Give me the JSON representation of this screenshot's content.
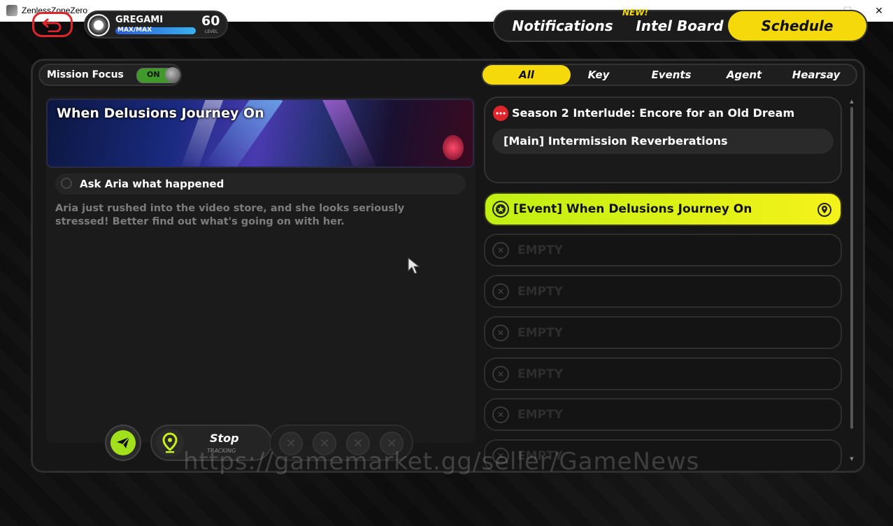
{
  "window": {
    "title": "ZenlessZoneZero",
    "minimize": "—",
    "maximize": "☐",
    "close": "✕"
  },
  "profile": {
    "name": "GREGAMI",
    "stamina": "MAX/MAX",
    "level": "60",
    "level_label": "LEVEL"
  },
  "top_tabs": [
    {
      "label": "Notifications"
    },
    {
      "label": "Intel Board",
      "badge": "NEW!"
    },
    {
      "label": "Schedule",
      "active": true
    }
  ],
  "mission_focus": {
    "label": "Mission Focus",
    "state": "ON"
  },
  "filters": [
    {
      "label": "All",
      "active": true
    },
    {
      "label": "Key"
    },
    {
      "label": "Events"
    },
    {
      "label": "Agent"
    },
    {
      "label": "Hearsay"
    }
  ],
  "detail": {
    "title": "When Delusions Journey On",
    "task": "Ask Aria what happened",
    "description": "Aria just rushed into the video store, and she looks seriously stressed! Better find out what's going on with her."
  },
  "tracking": {
    "stop_label": "Stop",
    "sub_label": "TRACKING"
  },
  "season": {
    "title": "Season 2 Interlude: Encore for an Old Dream",
    "mission": "[Main] Intermission Reverberations"
  },
  "event_card": {
    "label": "[Event] When Delusions Journey On"
  },
  "empty_slots": [
    "EMPTY",
    "EMPTY",
    "EMPTY",
    "EMPTY",
    "EMPTY",
    "EMPTY"
  ],
  "watermark": "https://gamemarket.gg/seller/GameNews",
  "colors": {
    "accent_yellow": "#f5d90a",
    "accent_lime": "#c8f01a",
    "back_red": "#e0242c",
    "toggle_green": "#3f9a2a"
  }
}
